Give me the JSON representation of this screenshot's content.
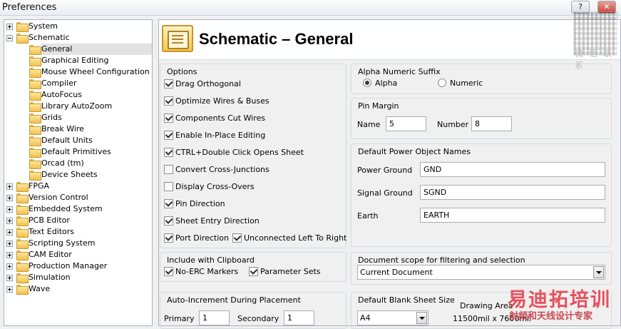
{
  "window": {
    "title": "Preferences",
    "help_button": "?",
    "close_button": "✕"
  },
  "tree": {
    "items": [
      {
        "label": "System",
        "level": 0,
        "expanded": false
      },
      {
        "label": "Schematic",
        "level": 0,
        "expanded": true
      },
      {
        "label": "General",
        "level": 1,
        "selected": true
      },
      {
        "label": "Graphical Editing",
        "level": 1
      },
      {
        "label": "Mouse Wheel Configuration",
        "level": 1
      },
      {
        "label": "Compiler",
        "level": 1
      },
      {
        "label": "AutoFocus",
        "level": 1
      },
      {
        "label": "Library AutoZoom",
        "level": 1
      },
      {
        "label": "Grids",
        "level": 1
      },
      {
        "label": "Break Wire",
        "level": 1
      },
      {
        "label": "Default Units",
        "level": 1
      },
      {
        "label": "Default Primitives",
        "level": 1
      },
      {
        "label": "Orcad (tm)",
        "level": 1
      },
      {
        "label": "Device Sheets",
        "level": 1
      },
      {
        "label": "FPGA",
        "level": 0,
        "expanded": false
      },
      {
        "label": "Version Control",
        "level": 0,
        "expanded": false
      },
      {
        "label": "Embedded System",
        "level": 0,
        "expanded": false
      },
      {
        "label": "PCB Editor",
        "level": 0,
        "expanded": false
      },
      {
        "label": "Text Editors",
        "level": 0,
        "expanded": false
      },
      {
        "label": "Scripting System",
        "level": 0,
        "expanded": false
      },
      {
        "label": "CAM Editor",
        "level": 0,
        "expanded": false
      },
      {
        "label": "Production Manager",
        "level": 0,
        "expanded": false
      },
      {
        "label": "Simulation",
        "level": 0,
        "expanded": false
      },
      {
        "label": "Wave",
        "level": 0,
        "expanded": false
      }
    ]
  },
  "page": {
    "title": "Schematic – General",
    "icon": "schematic-sheet-icon"
  },
  "options": {
    "title": "Options",
    "checkboxes": [
      {
        "label": "Drag Orthogonal",
        "checked": true
      },
      {
        "label": "Optimize Wires & Buses",
        "checked": true
      },
      {
        "label": "Components Cut Wires",
        "checked": true
      },
      {
        "label": "Enable In-Place Editing",
        "checked": true
      },
      {
        "label": "CTRL+Double Click Opens Sheet",
        "checked": true
      },
      {
        "label": "Convert Cross-Junctions",
        "checked": false
      },
      {
        "label": "Display Cross-Overs",
        "checked": false
      },
      {
        "label": "Pin Direction",
        "checked": true
      },
      {
        "label": "Sheet Entry Direction",
        "checked": true
      },
      {
        "label": "Port Direction",
        "checked": true
      },
      {
        "label": "Unconnected Left To Right",
        "checked": true
      }
    ]
  },
  "clipboard": {
    "title": "Include with Clipboard",
    "no_erc": {
      "label": "No-ERC Markers",
      "checked": true
    },
    "param_sets": {
      "label": "Parameter Sets",
      "checked": true
    }
  },
  "auto_increment": {
    "title": "Auto-Increment During Placement",
    "primary_label": "Primary",
    "primary_value": "1",
    "secondary_label": "Secondary",
    "secondary_value": "1"
  },
  "alpha_suffix": {
    "title": "Alpha Numeric Suffix",
    "alpha": {
      "label": "Alpha",
      "selected": true
    },
    "numeric": {
      "label": "Numeric",
      "selected": false
    }
  },
  "pin_margin": {
    "title": "Pin Margin",
    "name_label": "Name",
    "name_value": "5",
    "number_label": "Number",
    "number_value": "8"
  },
  "power_names": {
    "title": "Default Power Object Names",
    "power_ground_label": "Power Ground",
    "power_ground_value": "GND",
    "signal_ground_label": "Signal Ground",
    "signal_ground_value": "SGND",
    "earth_label": "Earth",
    "earth_value": "EARTH"
  },
  "doc_scope": {
    "title": "Document scope for filtering and selection",
    "value": "Current Document"
  },
  "blank_sheet": {
    "title": "Default Blank Sheet Size",
    "value": "A4",
    "drawing_area_label": "Drawing Area",
    "drawing_area_value": "11500mil x 7600mil"
  },
  "watermark": {
    "qr_caption": "微 信 联 系",
    "brand": "易迪拓培训",
    "tagline": "射频和天线设计专家"
  }
}
